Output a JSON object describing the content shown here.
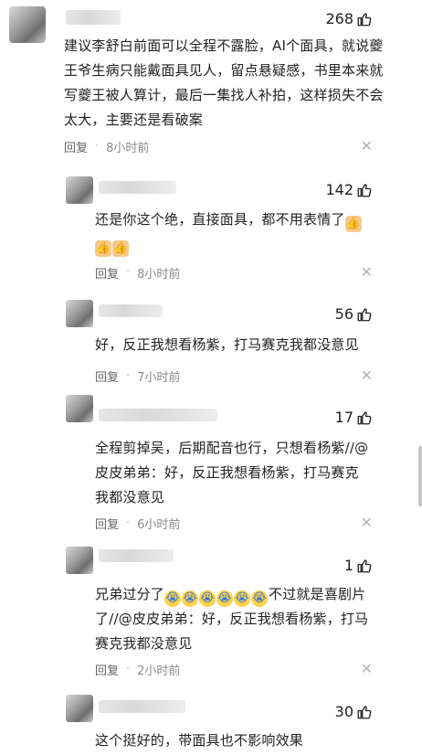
{
  "comments": [
    {
      "likes": "268",
      "text": "建议李舒白前面可以全程不露脸，AI个面具，就说夔王爷生病只能戴面具见人，留点悬疑感，书里本来就写夔王被人算计，最后一集找人补拍，这样损失不会太大，主要还是看破案",
      "reply_label": "回复",
      "time": "8小时前"
    }
  ],
  "replies": [
    {
      "likes": "142",
      "text": "还是你这个绝，直接面具，都不用表情了",
      "emoji_icons": [
        "thumbs-up-emoji",
        "thumbs-up-emoji",
        "thumbs-up-emoji"
      ],
      "reply_label": "回复",
      "time": "8小时前"
    },
    {
      "likes": "56",
      "text": "好，反正我想看杨紫，打马赛克我都没意见",
      "reply_label": "回复",
      "time": "7小时前"
    },
    {
      "likes": "17",
      "text": "全程剪掉吴，后期配音也行，只想看杨紫//@皮皮弟弟：好，反正我想看杨紫，打马赛克我都没意见",
      "reply_label": "回复",
      "time": "6小时前"
    },
    {
      "likes": "1",
      "text_before": "兄弟过分了",
      "emoji_icons": [
        "crying-emoji",
        "crying-emoji",
        "crying-emoji",
        "crying-emoji",
        "crying-emoji",
        "crying-emoji"
      ],
      "text_after": "不过就是喜剧片了//@皮皮弟弟：好，反正我想看杨紫，打马赛克我都没意见",
      "reply_label": "回复",
      "time": "2小时前"
    },
    {
      "likes": "30",
      "text": "这个挺好的，带面具也不影响效果"
    }
  ],
  "icons": {
    "like": "thumbs-up-icon",
    "close": "close-icon"
  }
}
